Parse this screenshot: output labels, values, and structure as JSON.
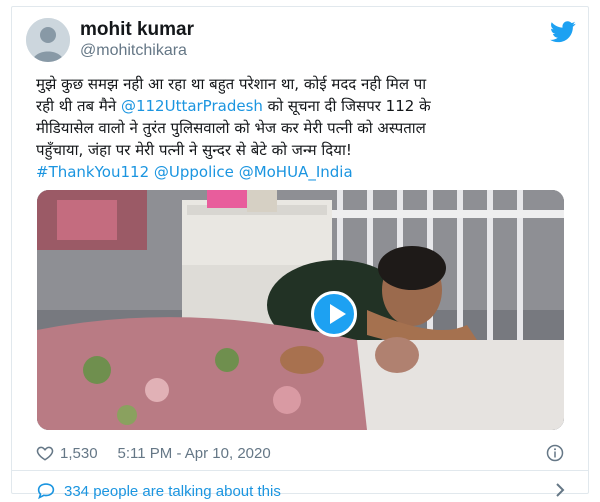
{
  "author": {
    "display_name": "mohit kumar",
    "handle": "@mohitchikara"
  },
  "tweet": {
    "line1": "मुझे कुछ समझ नही आ रहा था बहुत परेशान था, कोई मदद नही मिल पा",
    "line2_before": "रही थी तब मैने ",
    "line2_mention": "@112UttarPradesh",
    "line2_after": " को सूचना दी जिसपर 112 के",
    "line3": "मीडियासेल वालो ने तुरंत पुलिसवालो को भेज कर मेरी पत्नी को अस्पताल",
    "line4": "पहुँचाया, जंहा पर मेरी पत्नी ने सुन्दर से बेटे को जन्म दिया!",
    "hashtag": "#ThankYou112",
    "mention_police": "@Uppolice",
    "mention_mohua": "@MoHUA_India"
  },
  "stats": {
    "likes": "1,530",
    "timestamp": "5:11 PM - Apr 10, 2020"
  },
  "footer": {
    "talking_label": "334 people are talking about this"
  },
  "colors": {
    "link": "#1b95e0",
    "twitter_blue": "#1da1f2",
    "secondary_text": "#657786",
    "border": "#e1e8ed"
  },
  "icons": [
    "twitter-bird-icon",
    "play-icon",
    "heart-icon",
    "info-icon",
    "speech-bubble-icon",
    "chevron-right-icon"
  ]
}
